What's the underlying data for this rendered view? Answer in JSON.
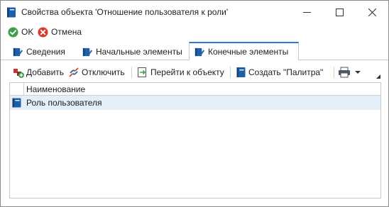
{
  "window": {
    "title": "Свойства объекта 'Отношение пользователя к роли'",
    "icon": "book-icon",
    "controls": [
      "minimize-icon",
      "maximize-icon",
      "close-icon"
    ]
  },
  "commands": {
    "ok_label": "OK",
    "cancel_label": "Отмена"
  },
  "tabs": [
    {
      "label": "Сведения",
      "icon": "book-pencil-icon",
      "active": false
    },
    {
      "label": "Начальные элементы",
      "icon": "book-pencil-icon",
      "active": false
    },
    {
      "label": "Конечные элементы",
      "icon": "book-pencil-icon",
      "active": true
    }
  ],
  "toolbar": {
    "add_label": "Добавить",
    "detach_label": "Отключить",
    "goto_label": "Перейти к объекту",
    "create_label": "Создать \"Палитра\"",
    "print_icon": "printer-icon"
  },
  "grid": {
    "column_header": "Наименование",
    "rows": [
      {
        "name": "Роль пользователя",
        "icon": "book-icon",
        "selected": true
      }
    ]
  },
  "colors": {
    "accent": "#2b79d0",
    "selected_row": "#e3eef9",
    "ok_green": "#3ea04a",
    "cancel_red": "#d83b2d"
  }
}
